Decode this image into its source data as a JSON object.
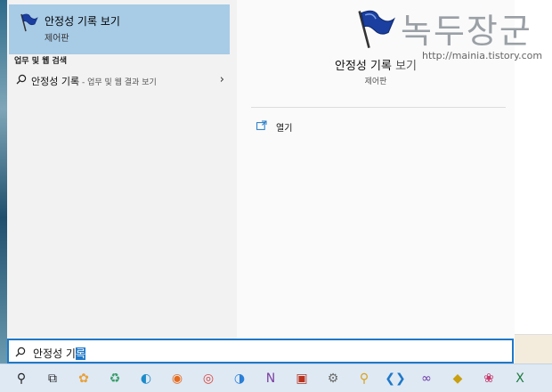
{
  "best_match": {
    "title": "안정성 기록 보기",
    "subtitle": "제어판",
    "icon": "flag-icon"
  },
  "web_section": {
    "heading": "업무 및 웹 검색",
    "item_query": "안정성 기록",
    "item_hint": " - 업무 및 웹 결과 보기",
    "chevron": "›"
  },
  "detail": {
    "title_main": "안정성 기록",
    "title_soft": " 보기",
    "subtitle": "제어판",
    "open_label": "열기"
  },
  "watermark": {
    "text": "녹두장군",
    "url": "http://mainia.tistory.com"
  },
  "search": {
    "typed_prefix": "안정성 기",
    "typed_selected": "록"
  },
  "colors": {
    "accent": "#1f78c8",
    "selected_bg": "#a8cbe6"
  },
  "taskbar": {
    "items": [
      {
        "name": "search-icon",
        "glyph": "⚲"
      },
      {
        "name": "task-view-icon",
        "glyph": "⧉"
      },
      {
        "name": "paint-app-icon",
        "glyph": "✿"
      },
      {
        "name": "recycle-app-icon",
        "glyph": "♻"
      },
      {
        "name": "edge-legacy-icon",
        "glyph": "◐"
      },
      {
        "name": "firefox-icon",
        "glyph": "◉"
      },
      {
        "name": "chrome-icon",
        "glyph": "◎"
      },
      {
        "name": "edge-icon",
        "glyph": "◑"
      },
      {
        "name": "onenote-icon",
        "glyph": "N"
      },
      {
        "name": "app-red-icon",
        "glyph": "▣"
      },
      {
        "name": "app-gear-icon",
        "glyph": "⚙"
      },
      {
        "name": "magnifier-icon",
        "glyph": "⚲"
      },
      {
        "name": "vscode-icon",
        "glyph": "❮❯"
      },
      {
        "name": "visual-studio-icon",
        "glyph": "∞"
      },
      {
        "name": "app-yellow-icon",
        "glyph": "◆"
      },
      {
        "name": "app-pink-icon",
        "glyph": "❀"
      },
      {
        "name": "excel-icon",
        "glyph": "X"
      }
    ]
  }
}
